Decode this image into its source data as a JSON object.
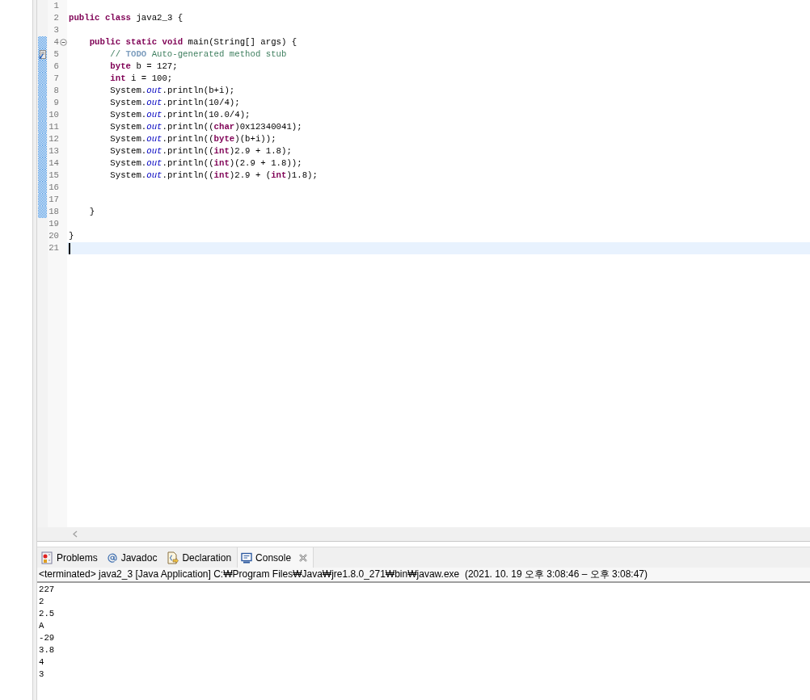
{
  "editor": {
    "lines": [
      {
        "number": "1",
        "kind": "code",
        "changed": false,
        "current": false
      },
      {
        "number": "2",
        "kind": "code",
        "changed": false,
        "current": false,
        "text": "**public** **class** java2_3 {"
      },
      {
        "number": "3",
        "kind": "code",
        "changed": false,
        "current": false
      },
      {
        "number": "4",
        "kind": "code",
        "changed": true,
        "current": false,
        "expanded": true,
        "text": "    **public** **static** **void** main(String[] args) {"
      },
      {
        "number": "5",
        "kind": "comment",
        "changed": true,
        "current": false,
        "task": true,
        "text": "        // **TODO** Auto-generated method stub"
      },
      {
        "number": "6",
        "kind": "code",
        "changed": true,
        "current": false,
        "text": "        **byte** b = 127;"
      },
      {
        "number": "7",
        "kind": "code",
        "changed": true,
        "current": false,
        "text": "        **int** i = 100;"
      },
      {
        "number": "8",
        "kind": "code",
        "changed": true,
        "current": false,
        "text": "        System.*out*.println(b+i);"
      },
      {
        "number": "9",
        "kind": "code",
        "changed": true,
        "current": false,
        "text": "        System.*out*.println(10/4);"
      },
      {
        "number": "10",
        "kind": "code",
        "changed": true,
        "current": false,
        "text": "        System.*out*.println(10.0/4);"
      },
      {
        "number": "11",
        "kind": "code",
        "changed": true,
        "current": false,
        "text": "        System.*out*.println((**char**)0x12340041);"
      },
      {
        "number": "12",
        "kind": "code",
        "changed": true,
        "current": false,
        "text": "        System.*out*.println((**byte**)(b+i));"
      },
      {
        "number": "13",
        "kind": "code",
        "changed": true,
        "current": false,
        "text": "        System.*out*.println((**int**)2.9 + 1.8);"
      },
      {
        "number": "14",
        "kind": "code",
        "changed": true,
        "current": false,
        "text": "        System.*out*.println((**int**)(2.9 + 1.8));"
      },
      {
        "number": "15",
        "kind": "code",
        "changed": true,
        "current": false,
        "text": "        System.*out*.println((**int**)2.9 + (**int**)1.8);"
      },
      {
        "number": "16",
        "kind": "code",
        "changed": true,
        "current": false
      },
      {
        "number": "17",
        "kind": "code",
        "changed": true,
        "current": false
      },
      {
        "number": "18",
        "kind": "code",
        "changed": true,
        "current": false,
        "text": "    }"
      },
      {
        "number": "19",
        "kind": "code",
        "changed": false,
        "current": false
      },
      {
        "number": "20",
        "kind": "code",
        "changed": false,
        "current": false,
        "text": "}"
      },
      {
        "number": "21",
        "kind": "code",
        "changed": false,
        "current": true
      }
    ]
  },
  "views": {
    "tabs": [
      {
        "label": "Problems",
        "kind": "problems",
        "selected": false
      },
      {
        "label": "Javadoc",
        "kind": "javadoc",
        "selected": false
      },
      {
        "label": "Declaration",
        "kind": "declaration",
        "selected": false
      },
      {
        "label": "Console",
        "kind": "console",
        "selected": true
      }
    ],
    "console": {
      "header": "<terminated> java2_3 [Java Application] C:₩Program Files₩Java₩jre1.8.0_271₩bin₩javaw.exe  (2021. 10. 19 오후 3:08:46 – 오후 3:08:47)",
      "output": [
        "227",
        "2",
        "2.5",
        "A",
        "-29",
        "3.8",
        "4",
        "3"
      ]
    }
  }
}
